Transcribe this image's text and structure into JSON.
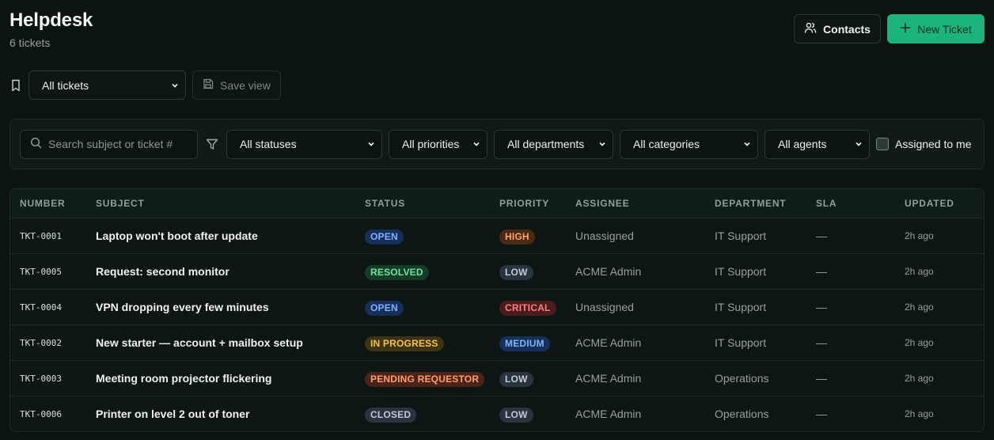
{
  "header": {
    "title": "Helpdesk",
    "subtitle": "6 tickets"
  },
  "actions": {
    "contacts_label": "Contacts",
    "new_ticket_label": "New Ticket"
  },
  "views": {
    "selected": "All tickets",
    "save_label": "Save view"
  },
  "filters": {
    "search_placeholder": "Search subject or ticket #",
    "status": "All statuses",
    "priority": "All priorities",
    "department": "All departments",
    "category": "All categories",
    "agent": "All agents",
    "assigned_to_me": "Assigned to me"
  },
  "table": {
    "columns": [
      "NUMBER",
      "SUBJECT",
      "STATUS",
      "PRIORITY",
      "ASSIGNEE",
      "DEPARTMENT",
      "SLA",
      "UPDATED"
    ],
    "rows": [
      {
        "number": "TKT-0001",
        "subject": "Laptop won't boot after update",
        "status": "OPEN",
        "priority": "HIGH",
        "assignee": "Unassigned",
        "department": "IT Support",
        "sla": "—",
        "updated": "2h ago"
      },
      {
        "number": "TKT-0005",
        "subject": "Request: second monitor",
        "status": "RESOLVED",
        "priority": "LOW",
        "assignee": "ACME Admin",
        "department": "IT Support",
        "sla": "—",
        "updated": "2h ago"
      },
      {
        "number": "TKT-0004",
        "subject": "VPN dropping every few minutes",
        "status": "OPEN",
        "priority": "CRITICAL",
        "assignee": "Unassigned",
        "department": "IT Support",
        "sla": "—",
        "updated": "2h ago"
      },
      {
        "number": "TKT-0002",
        "subject": "New starter — account + mailbox setup",
        "status": "IN PROGRESS",
        "priority": "MEDIUM",
        "assignee": "ACME Admin",
        "department": "IT Support",
        "sla": "—",
        "updated": "2h ago"
      },
      {
        "number": "TKT-0003",
        "subject": "Meeting room projector flickering",
        "status": "PENDING REQUESTOR",
        "priority": "LOW",
        "assignee": "ACME Admin",
        "department": "Operations",
        "sla": "—",
        "updated": "2h ago"
      },
      {
        "number": "TKT-0006",
        "subject": "Printer on level 2 out of toner",
        "status": "CLOSED",
        "priority": "LOW",
        "assignee": "ACME Admin",
        "department": "Operations",
        "sla": "—",
        "updated": "2h ago"
      }
    ]
  },
  "colors": {
    "accent": "#1bb57c",
    "badge_open_bg": "#16305a",
    "badge_open_fg": "#7fb2ff",
    "badge_resolved_bg": "#143d26",
    "badge_resolved_fg": "#6ee3a0",
    "badge_progress_bg": "#3d3312",
    "badge_progress_fg": "#f5c542",
    "badge_pending_bg": "#4a2418",
    "badge_pending_fg": "#ff9d6b",
    "badge_closed_bg": "#2a3340",
    "badge_closed_fg": "#c3cbd6",
    "badge_low_bg": "#2a3340",
    "badge_low_fg": "#c3cbd6",
    "badge_high_bg": "#4a2a16",
    "badge_high_fg": "#ffa45c",
    "badge_critical_bg": "#4a1c1c",
    "badge_critical_fg": "#ff8080",
    "badge_medium_bg": "#16305a",
    "badge_medium_fg": "#7fb2ff"
  },
  "icons": {
    "contacts": "users-icon",
    "new": "plus-icon",
    "bookmark": "bookmark-icon",
    "save": "floppy-disk-icon",
    "search": "search-icon",
    "filter": "funnel-icon",
    "chevron": "chevron-down-icon"
  }
}
